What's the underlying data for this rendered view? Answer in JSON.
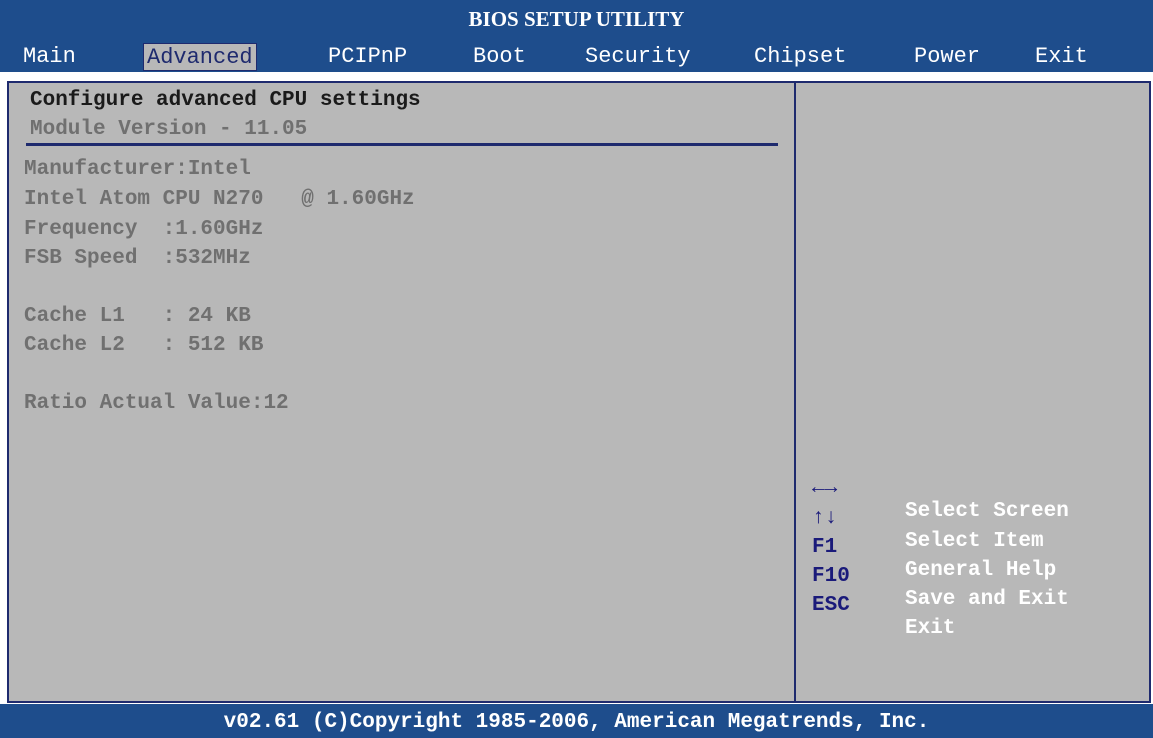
{
  "title": "BIOS SETUP UTILITY",
  "tabs": [
    {
      "label": "Main"
    },
    {
      "label": "Advanced"
    },
    {
      "label": "PCIPnP"
    },
    {
      "label": "Boot"
    },
    {
      "label": "Security"
    },
    {
      "label": "Chipset"
    },
    {
      "label": "Power"
    },
    {
      "label": "Exit"
    }
  ],
  "active_tab": "Advanced",
  "section": {
    "heading": "Configure advanced CPU settings",
    "module_version": "Module Version - 11.05"
  },
  "cpu_info": {
    "manufacturer": "Manufacturer:Intel",
    "model": "Intel Atom CPU N270   @ 1.60GHz",
    "frequency": "Frequency  :1.60GHz",
    "fsb_speed": "FSB Speed  :532MHz",
    "cache_l1": "Cache L1   : 24 KB",
    "cache_l2": "Cache L2   : 512 KB",
    "ratio_actual": "Ratio Actual Value:12"
  },
  "help_keys": [
    {
      "key": "←→",
      "desc": "Select Screen"
    },
    {
      "key": "↑↓",
      "desc": "Select Item"
    },
    {
      "key": "F1",
      "desc": "General Help"
    },
    {
      "key": "F10",
      "desc": "Save and Exit"
    },
    {
      "key": "ESC",
      "desc": "Exit"
    }
  ],
  "footer": "v02.61 (C)Copyright 1985-2006, American Megatrends, Inc.",
  "colors": {
    "bar_blue": "#1e4d8c",
    "panel_gray": "#b8b8b8",
    "border_navy": "#1e2a6e",
    "text_white": "#ffffff"
  }
}
